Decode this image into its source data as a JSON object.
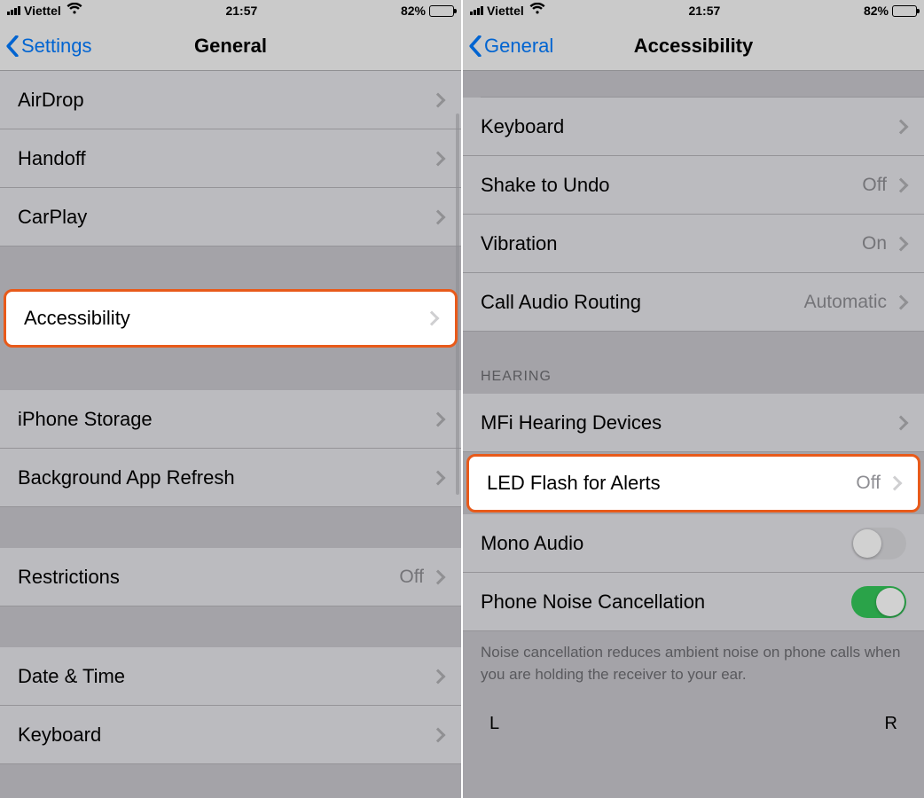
{
  "status": {
    "carrier": "Viettel",
    "time": "21:57",
    "battery_pct": "82%"
  },
  "left": {
    "back_label": "Settings",
    "title": "General",
    "rows": {
      "airdrop": "AirDrop",
      "handoff": "Handoff",
      "carplay": "CarPlay",
      "accessibility": "Accessibility",
      "iphone_storage": "iPhone Storage",
      "background_refresh": "Background App Refresh",
      "restrictions": "Restrictions",
      "restrictions_value": "Off",
      "date_time": "Date & Time",
      "keyboard": "Keyboard"
    }
  },
  "right": {
    "back_label": "General",
    "title": "Accessibility",
    "rows": {
      "keyboard": "Keyboard",
      "shake_to_undo": "Shake to Undo",
      "shake_to_undo_value": "Off",
      "vibration": "Vibration",
      "vibration_value": "On",
      "call_audio_routing": "Call Audio Routing",
      "call_audio_routing_value": "Automatic",
      "hearing_header": "HEARING",
      "mfi": "MFi Hearing Devices",
      "led_flash": "LED Flash for Alerts",
      "led_flash_value": "Off",
      "mono_audio": "Mono Audio",
      "phone_noise": "Phone Noise Cancellation",
      "footer": "Noise cancellation reduces ambient noise on phone calls when you are holding the receiver to your ear.",
      "balance_left": "L",
      "balance_right": "R"
    }
  }
}
